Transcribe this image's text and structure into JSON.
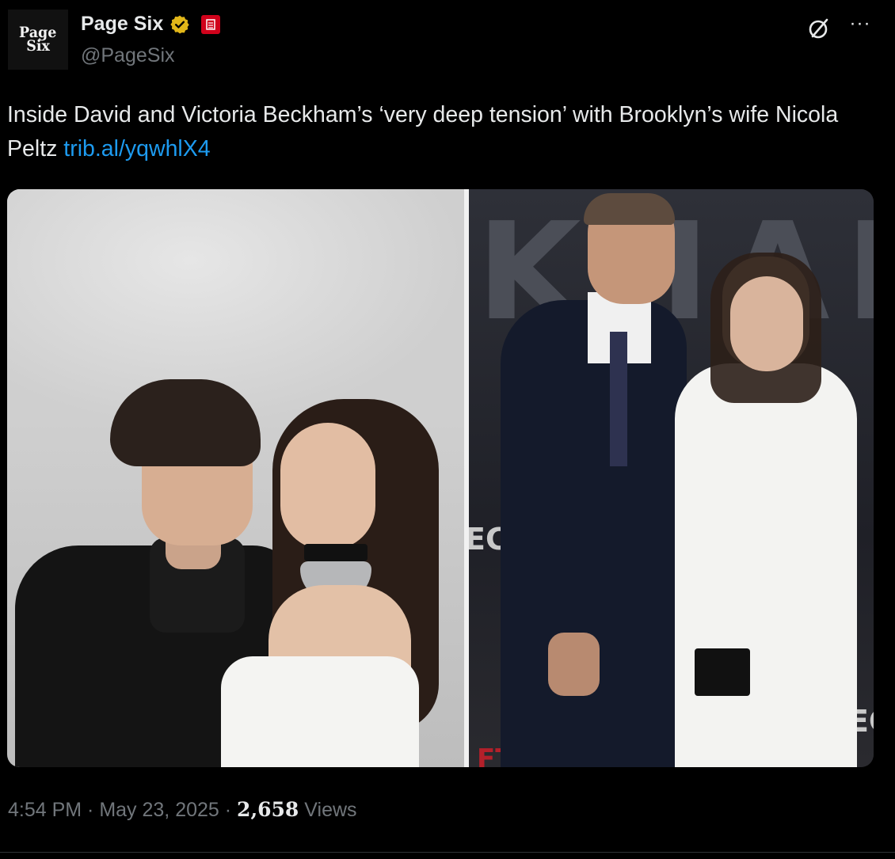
{
  "author": {
    "avatar_line1": "Page",
    "avatar_line2": "Six",
    "display_name": "Page Six",
    "handle": "@PageSix"
  },
  "tweet": {
    "text": "Inside David and Victoria Beckham’s ‘very deep tension’ with Brooklyn’s wife Nicola Peltz ",
    "link": "trib.al/yqwhlX4"
  },
  "footer": {
    "time": "4:54 PM",
    "sep1": " · ",
    "date": "May 23, 2025",
    "sep2": " · ",
    "views_count": "2,658",
    "views_label": " Views"
  },
  "colors": {
    "background": "#000000",
    "text": "#e7e9ea",
    "muted": "#71767b",
    "link": "#1d9bf0",
    "verified_badge": "#e2b719"
  },
  "icons": [
    "verified-badge-icon",
    "affiliate-badge-icon",
    "grok-icon",
    "more-icon"
  ]
}
